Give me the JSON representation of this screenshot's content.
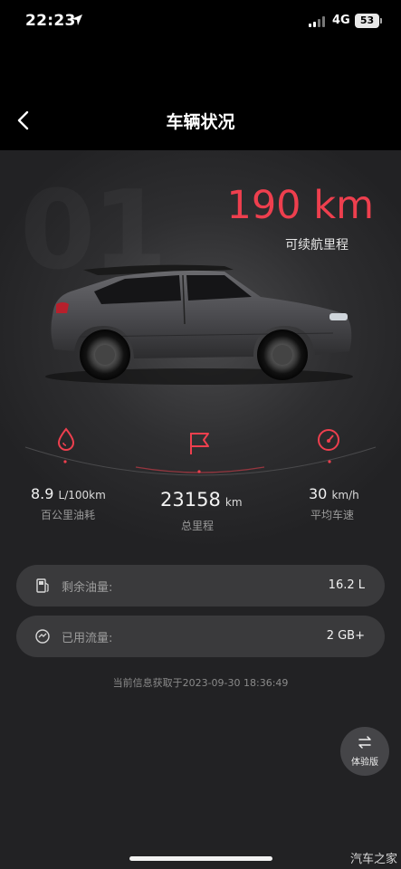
{
  "status_bar": {
    "time": "22:23",
    "network": "4G",
    "battery": "53"
  },
  "header": {
    "title": "车辆状况"
  },
  "range": {
    "watermark": "01",
    "value": "190 km",
    "label": "可续航里程"
  },
  "stats": {
    "fuel_consumption": {
      "value": "8.9",
      "unit": "L/100km",
      "label": "百公里油耗"
    },
    "total_mileage": {
      "value": "23158",
      "unit": "km",
      "label": "总里程"
    },
    "avg_speed": {
      "value": "30",
      "unit": "km/h",
      "label": "平均车速"
    }
  },
  "info_rows": {
    "fuel_remaining": {
      "label": "剩余油量:",
      "value": "16.2 L"
    },
    "data_used": {
      "label": "已用流量:",
      "value": "2 GB+"
    }
  },
  "updated_text": "当前信息获取于2023-09-30 18:36:49",
  "fab": {
    "label": "体验版"
  },
  "watermark_brand": "汽车之家",
  "colors": {
    "accent": "#ee3f4e",
    "panel": "#3a3a3c",
    "background": "#000000"
  },
  "icons": {
    "back": "back-chevron-icon",
    "fuel_consumption": "fuel-drop-icon",
    "total_mileage": "flag-icon",
    "avg_speed": "speedometer-icon",
    "fuel_remaining": "fuel-pump-icon",
    "data_used": "data-gauge-icon",
    "fab": "swap-arrows-icon"
  }
}
